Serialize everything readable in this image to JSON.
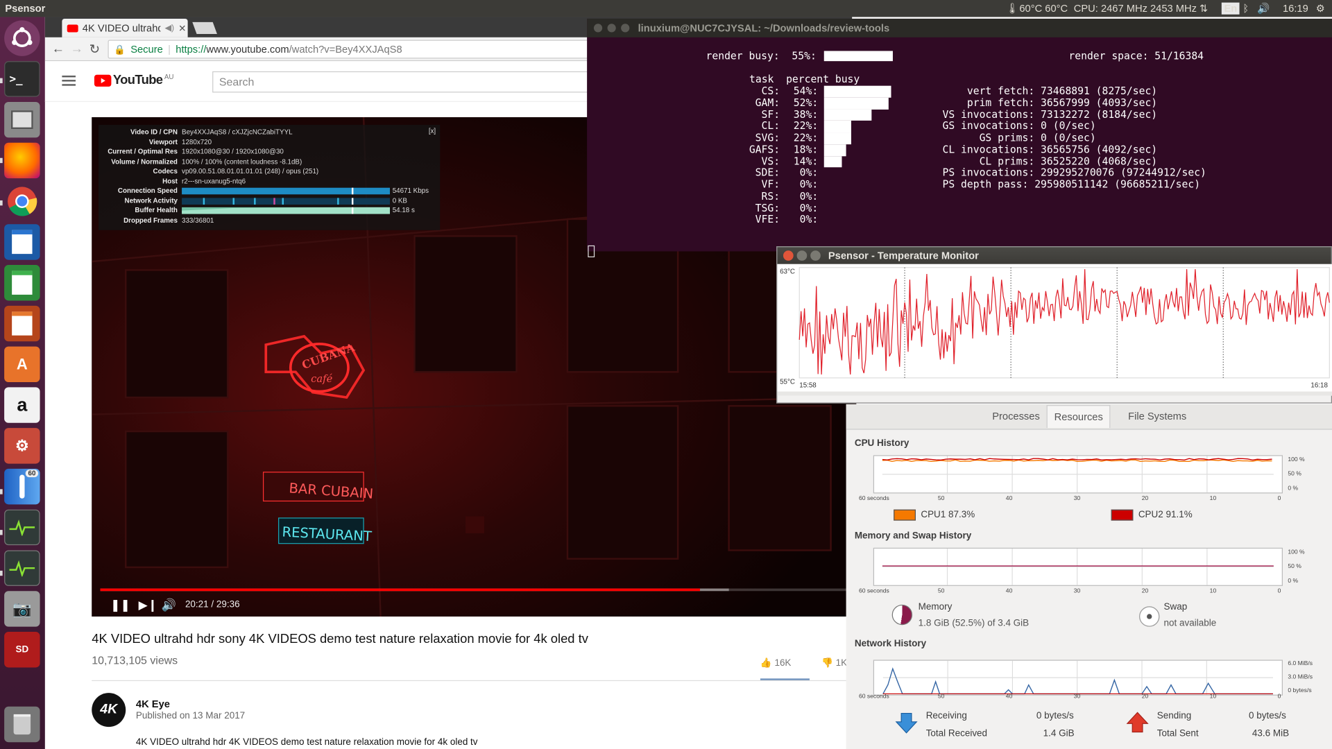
{
  "topbar": {
    "app": "Psensor",
    "temps": "60°C 60°C",
    "cpu": "CPU: 2467 MHz 2453 MHz",
    "keyboard": "En",
    "time": "16:19"
  },
  "launcher": {
    "items": [
      "Ubuntu Dash",
      "Terminal",
      "Files",
      "Firefox",
      "Chrome",
      "LibreOffice Writer",
      "LibreOffice Calc",
      "LibreOffice Impress",
      "Ubuntu Software",
      "Amazon",
      "System Settings",
      "Psensor",
      "System Monitor",
      "System Monitor",
      "Screenshot",
      "SD Card",
      "Trash"
    ],
    "psensor_badge": "60"
  },
  "browser": {
    "tab_title": "4K VIDEO ultrahd",
    "secure_label": "Secure",
    "url_scheme": "https://",
    "url_host": "www.youtube.com",
    "url_path": "/watch?v=Bey4XXJAqS8"
  },
  "youtube": {
    "logo": "YouTube",
    "region": "AU",
    "search_placeholder": "Search",
    "video_title": "4K VIDEO ultrahd hdr sony 4K VIDEOS demo test nature relaxation movie for 4k oled tv",
    "views": "10,713,105 views",
    "likes": "16K",
    "dislikes": "1K",
    "channel": "4K Eye",
    "channel_avatar": "4K",
    "published": "Published on 13 Mar 2017",
    "description": "4K VIDEO ultrahd hdr 4K VIDEOS demo test nature relaxation movie for 4k oled tv",
    "player_time": "20:21 / 29:36",
    "played_fraction": 0.6875
  },
  "stats": {
    "close": "[x]",
    "rows": [
      {
        "k": "Video ID / CPN",
        "v": "Bey4XXJAqS8 / cXJZjcNCZabiTYYL"
      },
      {
        "k": "Viewport",
        "v": "1280x720"
      },
      {
        "k": "Current / Optimal Res",
        "v": "1920x1080@30 / 1920x1080@30"
      },
      {
        "k": "Volume / Normalized",
        "v": "100% / 100% (content loudness -8.1dB)"
      },
      {
        "k": "Codecs",
        "v": "vp09.00.51.08.01.01.01.01 (248) / opus (251)"
      },
      {
        "k": "Host",
        "v": "r2---sn-uxanug5-ntq6"
      }
    ],
    "connection_label": "Connection Speed",
    "connection_value": "54671 Kbps",
    "network_label": "Network Activity",
    "network_value": "0 KB",
    "buffer_label": "Buffer Health",
    "buffer_value": "54.18 s",
    "dropped_label": "Dropped Frames",
    "dropped_value": "333/36801"
  },
  "sign_text": {
    "cubana": "CUBANA",
    "cafe": "café",
    "bar": "BAR CUBAIN",
    "restaurant": "RESTAURANT"
  },
  "terminal": {
    "title": "linuxium@NUC7CJYSAL: ~/Downloads/review-tools",
    "render_busy": "render busy:  55%:",
    "render_busy_pct": 55,
    "render_space": "render space: 51/16384",
    "header": "task  percent busy",
    "tasks": [
      {
        "name": "CS:",
        "pct": "54%:",
        "val": 54
      },
      {
        "name": "GAM:",
        "pct": "52%:",
        "val": 52
      },
      {
        "name": "SF:",
        "pct": "38%:",
        "val": 38
      },
      {
        "name": "CL:",
        "pct": "22%:",
        "val": 22
      },
      {
        "name": "SVG:",
        "pct": "22%:",
        "val": 22
      },
      {
        "name": "GAFS:",
        "pct": "18%:",
        "val": 18
      },
      {
        "name": "VS:",
        "pct": "14%:",
        "val": 14
      },
      {
        "name": "SDE:",
        "pct": "0%:",
        "val": 0
      },
      {
        "name": "VF:",
        "pct": "0%:",
        "val": 0
      },
      {
        "name": "RS:",
        "pct": "0%:",
        "val": 0
      },
      {
        "name": "TSG:",
        "pct": "0%:",
        "val": 0
      },
      {
        "name": "VFE:",
        "pct": "0%:",
        "val": 0
      }
    ],
    "counters": [
      "      vert fetch: 73468891 (8275/sec)",
      "      prim fetch: 36567999 (4093/sec)",
      "  VS invocations: 73132272 (8184/sec)",
      "  GS invocations: 0 (0/sec)",
      "        GS prims: 0 (0/sec)",
      "  CL invocations: 36565756 (4092/sec)",
      "        CL prims: 36525220 (4068/sec)",
      "  PS invocations: 299295270076 (97244912/sec)",
      "  PS depth pass: 295980511142 (96685211/sec)"
    ]
  },
  "psensor": {
    "title": "Psensor - Temperature Monitor",
    "y_max": "63°C",
    "y_min": "55°C",
    "x_start": "15:58",
    "x_end": "16:18",
    "line_color": "#e0202a"
  },
  "sysmon": {
    "tabs": [
      "Processes",
      "Resources",
      "File Systems"
    ],
    "cpu_title": "CPU History",
    "mem_title": "Memory and Swap History",
    "net_title": "Network History",
    "x_ticks": [
      "60 seconds",
      "50",
      "40",
      "30",
      "20",
      "10",
      "0"
    ],
    "pct_ticks": [
      "100 %",
      "50 %",
      "0 %"
    ],
    "net_ticks": [
      "6.0 MiB/s",
      "3.0 MiB/s",
      "0 bytes/s"
    ],
    "cpu1": {
      "label": "CPU1",
      "value": "87.3%",
      "color": "#f57900"
    },
    "cpu2": {
      "label": "CPU2",
      "value": "91.1%",
      "color": "#cc0000"
    },
    "memory": {
      "label": "Memory",
      "value": "1.8 GiB (52.5%) of 3.4 GiB",
      "fraction": 0.525
    },
    "swap": {
      "label": "Swap",
      "value": "not available"
    },
    "receiving": {
      "label": "Receiving",
      "rate": "0 bytes/s",
      "total_label": "Total Received",
      "total": "1.4 GiB"
    },
    "sending": {
      "label": "Sending",
      "rate": "0 bytes/s",
      "total_label": "Total Sent",
      "total": "43.6 MiB"
    }
  }
}
